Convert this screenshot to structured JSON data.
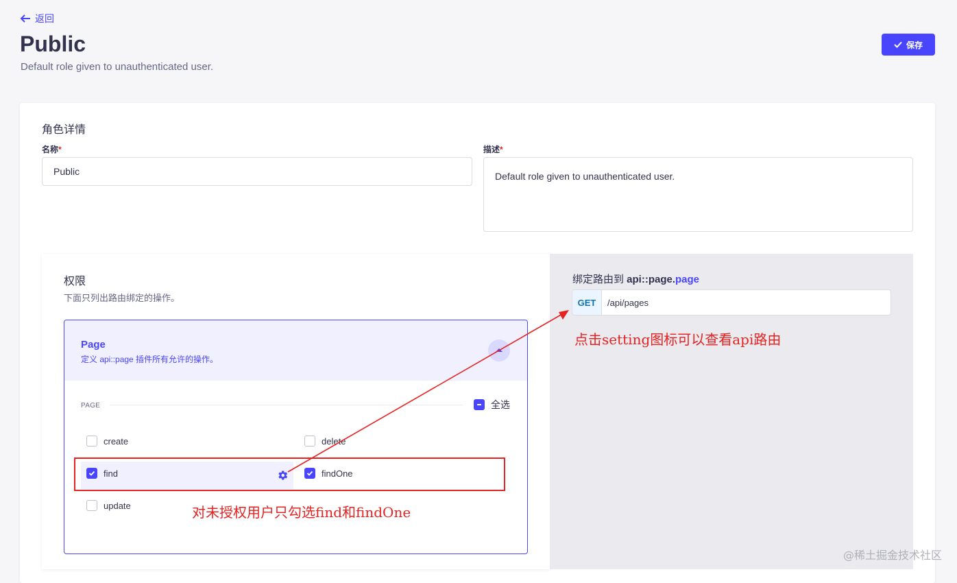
{
  "header": {
    "back_label": "返回",
    "title": "Public",
    "subtitle": "Default role given to unauthenticated user.",
    "save_label": "保存"
  },
  "role_details": {
    "section_title": "角色详情",
    "name_label": "名称",
    "name_value": "Public",
    "desc_label": "描述",
    "desc_value": "Default role given to unauthenticated user.",
    "required_mark": "*"
  },
  "permissions": {
    "title": "权限",
    "description": "下面只列出路由绑定的操作。",
    "accordion": {
      "title": "Page",
      "subtitle": "定义 api::page 插件所有允许的操作。",
      "group_label": "PAGE",
      "select_all_label": "全选",
      "actions": [
        {
          "label": "create",
          "checked": false
        },
        {
          "label": "delete",
          "checked": false
        },
        {
          "label": "find",
          "checked": true
        },
        {
          "label": "findOne",
          "checked": true
        },
        {
          "label": "update",
          "checked": false
        }
      ]
    }
  },
  "route_panel": {
    "title_prefix": "绑定路由到 ",
    "title_api": "api::page.",
    "title_accent": "page",
    "method": "GET",
    "path": "/api/pages"
  },
  "annotations": {
    "setting_note": "点击setting图标可以查看api路由",
    "select_note": "对未授权用户只勾选find和findOne"
  },
  "watermark": "@稀土掘金技术社区",
  "colors": {
    "accent": "#4945ff",
    "annotation_red": "#e62222",
    "background": "#f6f6f9"
  }
}
